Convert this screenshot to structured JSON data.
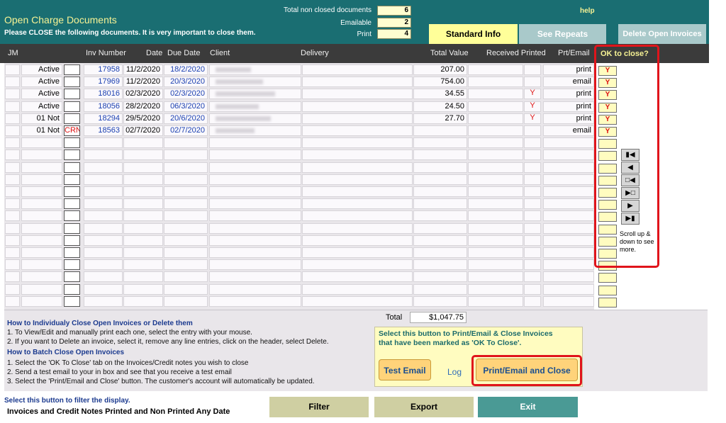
{
  "header": {
    "title": "Open Charge Documents",
    "subtitle": "Please CLOSE the following documents. It is very important to close them.",
    "stats": [
      {
        "label": "Total non closed documents",
        "value": "6"
      },
      {
        "label": "Emailable",
        "value": "2"
      },
      {
        "label": "Print",
        "value": "4"
      }
    ],
    "help_link": "help",
    "tabs": {
      "standard_info": "Standard Info",
      "see_repeats": "See Repeats",
      "delete_open": "Delete Open Invoices"
    }
  },
  "table": {
    "columns": {
      "jm": "JM",
      "inv_number": "Inv Number",
      "date": "Date",
      "due_date": "Due Date",
      "client": "Client",
      "delivery": "Delivery",
      "total_value": "Total Value",
      "received_printed": "Received Printed",
      "prt_email": "Prt/Email",
      "ok_to_close": "OK to close?"
    },
    "rows": [
      {
        "status": "Active",
        "type": "",
        "inv": "17958",
        "date": "11/2/2020",
        "due": "18/2/2020",
        "total": "207.00",
        "printed": "",
        "prt": "print",
        "ok": "Y"
      },
      {
        "status": "Active",
        "type": "",
        "inv": "17969",
        "date": "11/2/2020",
        "due": "20/3/2020",
        "total": "754.00",
        "printed": "",
        "prt": "email",
        "ok": "Y"
      },
      {
        "status": "Active",
        "type": "",
        "inv": "18016",
        "date": "02/3/2020",
        "due": "02/3/2020",
        "total": "34.55",
        "printed": "Y",
        "prt": "print",
        "ok": "Y"
      },
      {
        "status": "Active",
        "type": "",
        "inv": "18056",
        "date": "28/2/2020",
        "due": "06/3/2020",
        "total": "24.50",
        "printed": "Y",
        "prt": "print",
        "ok": "Y"
      },
      {
        "status": "01 Not",
        "type": "",
        "inv": "18294",
        "date": "29/5/2020",
        "due": "20/6/2020",
        "total": "27.70",
        "printed": "Y",
        "prt": "print",
        "ok": "Y"
      },
      {
        "status": "01 Not",
        "type": "CRN",
        "inv": "18563",
        "date": "02/7/2020",
        "due": "02/7/2020",
        "total": "",
        "printed": "",
        "prt": "email",
        "ok": "Y"
      }
    ],
    "scroll_note": "Scroll up & down to see more."
  },
  "instructions": {
    "individual_title": "How to Individualy Close Open Invoices or Delete them",
    "individual_1": "1. To View/Edit and manually print each one, select the entry with your mouse.",
    "individual_2": "2. If you want to Delete an invoice, select it, remove any line entries, click on the header, select Delete.",
    "batch_title": "How to Batch Close Open Invoices",
    "batch_1": "1. Select the 'OK To Close' tab on the Invoices/Credit notes you wish to close",
    "batch_2": "2. Send a test email to your  in box and see that you receive a test email",
    "batch_3": "3. Select the 'Print/Email and Close' button. The customer's account will automatically be updated."
  },
  "totals": {
    "label": "Total",
    "value": "$1,047.75"
  },
  "batch": {
    "text_1": "Select this button to Print/Email & Close Invoices",
    "text_2": "that have been marked as 'OK To Close'.",
    "test_email": "Test Email",
    "log": "Log",
    "print_close": "Print/Email and Close"
  },
  "footer": {
    "filter_hint": "Select this button to filter the display.",
    "filter_value": "Invoices and Credit Notes Printed and Non Printed Any Date",
    "filter_btn": "Filter",
    "export_btn": "Export",
    "exit_btn": "Exit"
  },
  "colors": {
    "teal_header": "#1a6e72",
    "title_yellow": "#f6f294",
    "highlight_red": "#e0141b",
    "tab_active": "#ffff99",
    "footer_olive": "#cfcfa2",
    "exit_teal": "#4a9a95"
  }
}
